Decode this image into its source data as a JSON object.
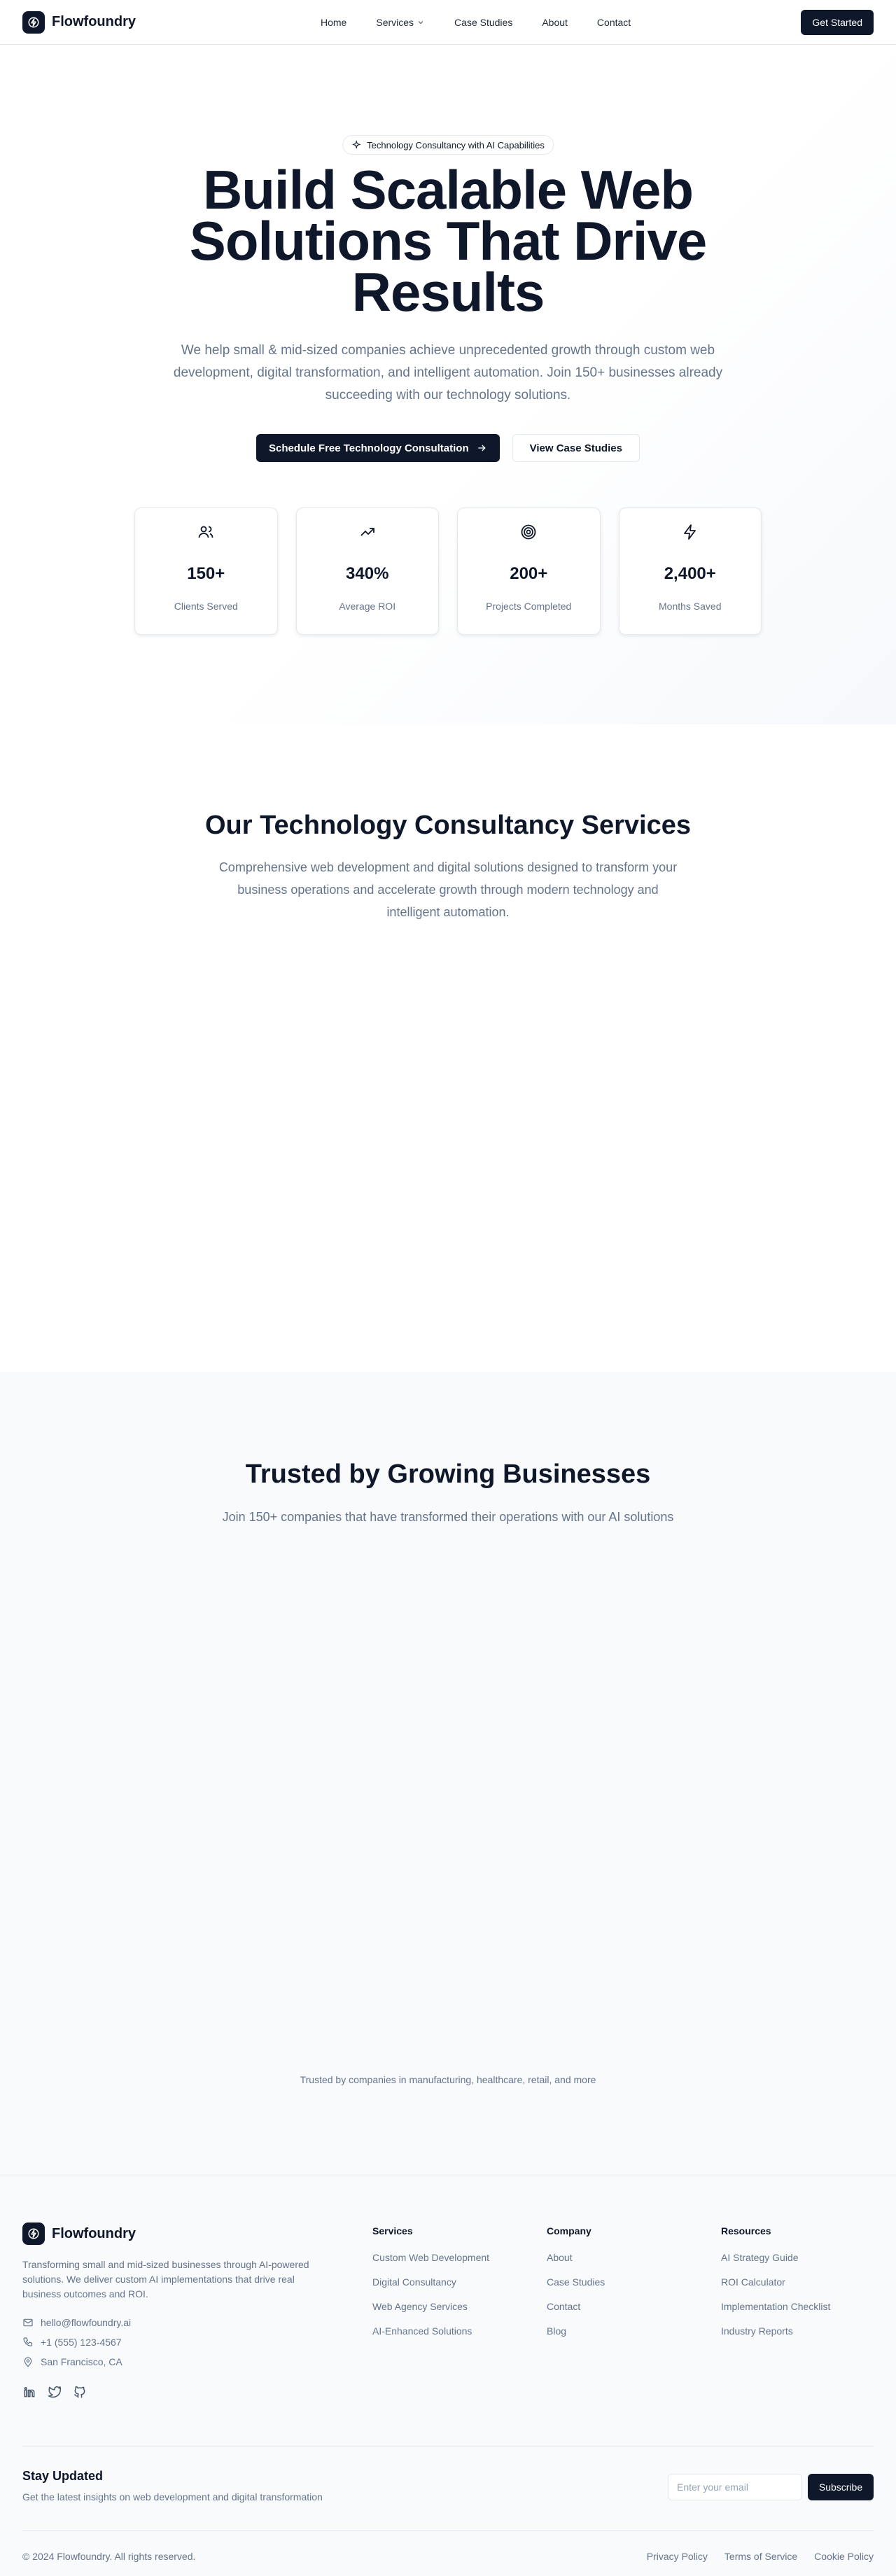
{
  "nav": {
    "brand": "Flowfoundry",
    "links": [
      "Home",
      "Services",
      "Case Studies",
      "About",
      "Contact"
    ],
    "cta": "Get Started"
  },
  "hero": {
    "badge": "Technology Consultancy with AI Capabilities",
    "title": "Build Scalable Web Solutions That Drive Results",
    "subtitle": "We help small & mid-sized companies achieve unprecedented growth through custom web development, digital transformation, and intelligent automation. Join 150+ businesses already succeeding with our technology solutions.",
    "primary_cta": "Schedule Free Technology Consultation",
    "secondary_cta": "View Case Studies",
    "stats": [
      {
        "icon": "users-icon",
        "value": "150+",
        "label": "Clients Served"
      },
      {
        "icon": "trending-up-icon",
        "value": "340%",
        "label": "Average ROI"
      },
      {
        "icon": "target-icon",
        "value": "200+",
        "label": "Projects Completed"
      },
      {
        "icon": "zap-icon",
        "value": "2,400+",
        "label": "Months Saved"
      }
    ]
  },
  "services": {
    "title": "Our Technology Consultancy Services",
    "subtitle": "Comprehensive web development and digital solutions designed to transform your business operations and accelerate growth through modern technology and intelligent automation."
  },
  "trusted": {
    "title": "Trusted by Growing Businesses",
    "subtitle": "Join 150+ companies that have transformed their operations with our AI solutions",
    "note": "Trusted by companies in manufacturing, healthcare, retail, and more"
  },
  "footer": {
    "brand": "Flowfoundry",
    "description": "Transforming small and mid-sized businesses through AI-powered solutions. We deliver custom AI implementations that drive real business outcomes and ROI.",
    "email": "hello@flowfoundry.ai",
    "phone": "+1 (555) 123-4567",
    "location": "San Francisco, CA",
    "columns": [
      {
        "title": "Services",
        "items": [
          "Custom Web Development",
          "Digital Consultancy",
          "Web Agency Services",
          "AI-Enhanced Solutions"
        ]
      },
      {
        "title": "Company",
        "items": [
          "About",
          "Case Studies",
          "Contact",
          "Blog"
        ]
      },
      {
        "title": "Resources",
        "items": [
          "AI Strategy Guide",
          "ROI Calculator",
          "Implementation Checklist",
          "Industry Reports"
        ]
      }
    ],
    "newsletter": {
      "title": "Stay Updated",
      "subtitle": "Get the latest insights on web development and digital transformation",
      "placeholder": "Enter your email",
      "button": "Subscribe"
    },
    "copyright": "© 2024 Flowfoundry. All rights reserved.",
    "legal": [
      "Privacy Policy",
      "Terms of Service",
      "Cookie Policy"
    ]
  }
}
